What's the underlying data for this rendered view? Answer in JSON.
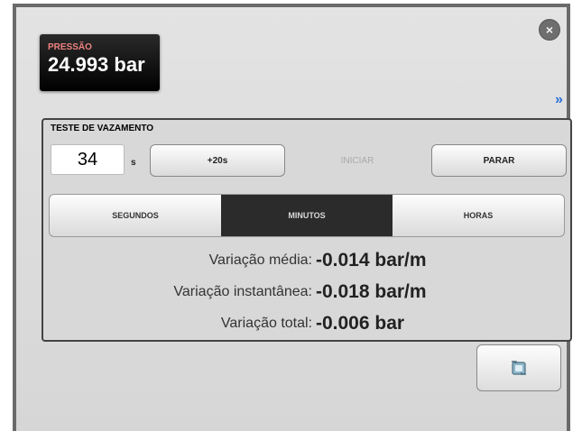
{
  "dialog": {
    "close_icon": "×",
    "expand_icon": "»"
  },
  "pressure": {
    "label": "PRESSÃO",
    "value": "24.993 bar"
  },
  "leak_test": {
    "title": "TESTE DE VAZAMENTO",
    "timer_value": "34",
    "timer_unit": "s",
    "buttons": {
      "plus20": "+20s",
      "start": "INICIAR",
      "stop": "PARAR"
    },
    "units": [
      {
        "label": "SEGUNDOS",
        "active": false
      },
      {
        "label": "MINUTOS",
        "active": true
      },
      {
        "label": "HORAS",
        "active": false
      }
    ],
    "metrics": [
      {
        "label": "Variação média:",
        "value": "-0.014 bar/m"
      },
      {
        "label": "Variação instantânea:",
        "value": "-0.018 bar/m"
      },
      {
        "label": "Variação total:",
        "value": "-0.006 bar"
      }
    ]
  },
  "footer": {
    "refresh_icon": "refresh-icon"
  },
  "colors": {
    "pressure_label": "#f08080",
    "expand_icon": "#2a6fd6",
    "active_segment": "#2b2b2b"
  }
}
